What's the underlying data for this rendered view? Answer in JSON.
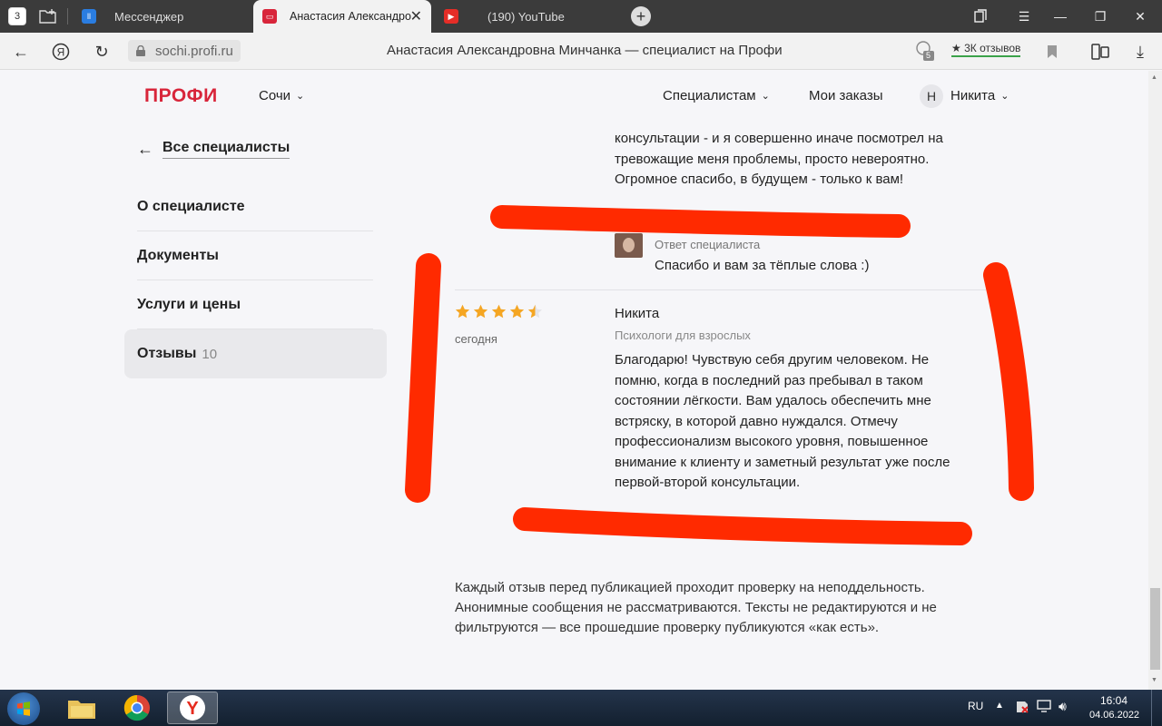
{
  "browser": {
    "tab_count": "3",
    "tabs": [
      {
        "title": "Мессенджер"
      },
      {
        "title": "Анастасия Александрo"
      },
      {
        "title": "(190) YouTube"
      }
    ],
    "url": "sochi.profi.ru",
    "page_title": "Анастасия Александровна Минчанка — специалист на Профи",
    "extension_badge": "5",
    "reviews_chip": "★ 3К отзывов"
  },
  "header": {
    "logo": "ПРОФИ",
    "city": "Сочи",
    "specialists": "Специалистам",
    "my_orders": "Мои заказы",
    "user_initial": "Н",
    "user_name": "Никита"
  },
  "sidebar": {
    "back": "Все специалисты",
    "items": [
      {
        "label": "О специалисте"
      },
      {
        "label": "Документы"
      },
      {
        "label": "Услуги и цены"
      },
      {
        "label": "Отзывы",
        "count": "10"
      }
    ]
  },
  "reviews": {
    "previous_text_lines": [
      "консультации - и я совершенно иначе посмотрел на",
      "тревожащие меня проблемы, просто невероятно.",
      "Огромное спасибо, в будущем - только к вам!"
    ],
    "reply_label": "Ответ специалиста",
    "reply_text": "Спасибо и вам за тёплые слова :)",
    "current": {
      "rating": 4.5,
      "date": "сегодня",
      "author": "Никита",
      "category": "Психологи для взрослых",
      "text_lines": [
        "Благодарю! Чувствую себя другим человеком. Не",
        "помню, когда в последний раз пребывал в таком",
        "состоянии лёгкости. Вам удалось обеспечить мне",
        "встряску, в которой давно нуждался. Отмечу",
        "профессионализм высокого уровня, повышенное",
        "внимание к клиенту и заметный результат уже после",
        "первой-второй консультации."
      ]
    }
  },
  "footnote_lines": [
    "Каждый отзыв перед публикацией проходит проверку на неподдельность.",
    "Анонимные сообщения не рассматриваются. Тексты не редактируются и не",
    "фильтруются — все прошедшие проверку публикуются «как есть»."
  ],
  "taskbar": {
    "lang": "RU",
    "time": "16:04",
    "date": "04.06.2022"
  },
  "colors": {
    "brand": "#d8253a",
    "star": "#f5a623",
    "annotation": "#ff2a00"
  }
}
